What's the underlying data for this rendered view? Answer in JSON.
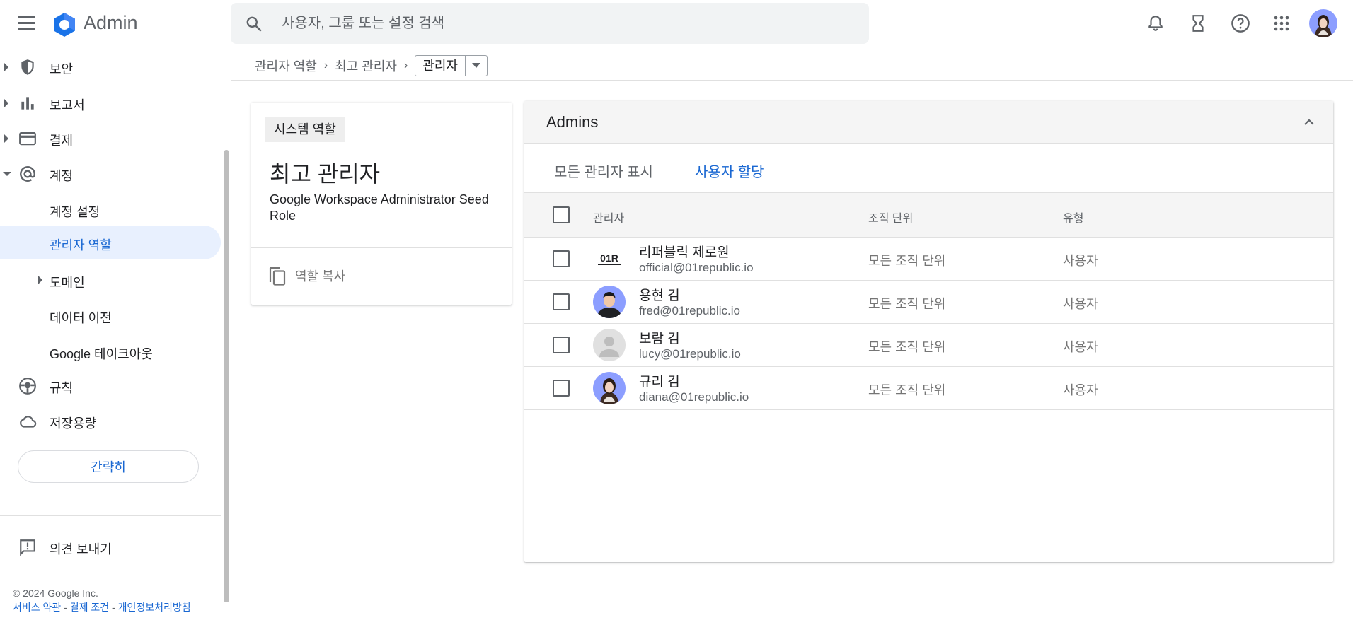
{
  "app": {
    "title": "Admin"
  },
  "search": {
    "placeholder": "사용자, 그룹 또는 설정 검색"
  },
  "header_icons": [
    "notifications-icon",
    "hourglass-icon",
    "help-icon",
    "apps-icon"
  ],
  "sidebar": {
    "items": [
      {
        "label": "보안",
        "icon": "shield-icon"
      },
      {
        "label": "보고서",
        "icon": "bar-chart-icon"
      },
      {
        "label": "결제",
        "icon": "credit-card-icon"
      },
      {
        "label": "계정",
        "icon": "at-sign-icon"
      }
    ],
    "account_sub": [
      {
        "label": "계정 설정"
      },
      {
        "label": "관리자 역할"
      },
      {
        "label": "도메인"
      },
      {
        "label": "데이터 이전"
      },
      {
        "label": "Google 테이크아웃"
      }
    ],
    "after": [
      {
        "label": "규칙",
        "icon": "rules-icon"
      },
      {
        "label": "저장용량",
        "icon": "cloud-icon"
      }
    ],
    "collapse_label": "간략히",
    "feedback_label": "의견 보내기",
    "copyright": "© 2024 Google Inc.",
    "links": [
      "서비스 약관",
      "결제 조건",
      "개인정보처리방침"
    ],
    "link_separator": " - "
  },
  "breadcrumb": {
    "items": [
      "관리자 역할",
      "최고 관리자"
    ],
    "current": "관리자"
  },
  "role_card": {
    "chip": "시스템 역할",
    "title": "최고 관리자",
    "description": "Google Workspace Administrator Seed Role",
    "copy_label": "역할 복사"
  },
  "admins": {
    "title": "Admins",
    "tabs": {
      "show_all": "모든 관리자 표시",
      "assign": "사용자 할당"
    },
    "columns": {
      "admin": "관리자",
      "org_unit": "조직 단위",
      "type": "유형"
    },
    "rows": [
      {
        "name": "리퍼블릭 제로원",
        "email": "official@01republic.io",
        "org": "모든 조직 단위",
        "type": "사용자",
        "avatar": "logo-01r",
        "logo_text": "01R"
      },
      {
        "name": "용현 김",
        "email": "fred@01republic.io",
        "org": "모든 조직 단위",
        "type": "사용자",
        "avatar": "photo-man"
      },
      {
        "name": "보람 김",
        "email": "lucy@01republic.io",
        "org": "모든 조직 단위",
        "type": "사용자",
        "avatar": "default-person"
      },
      {
        "name": "규리 김",
        "email": "diana@01republic.io",
        "org": "모든 조직 단위",
        "type": "사용자",
        "avatar": "photo-woman"
      }
    ]
  },
  "colors": {
    "accent": "#1967d2",
    "active_bg": "#e8f0fe",
    "logo_blue": "#4285f4",
    "avatar_bg": "#8c9eff"
  }
}
